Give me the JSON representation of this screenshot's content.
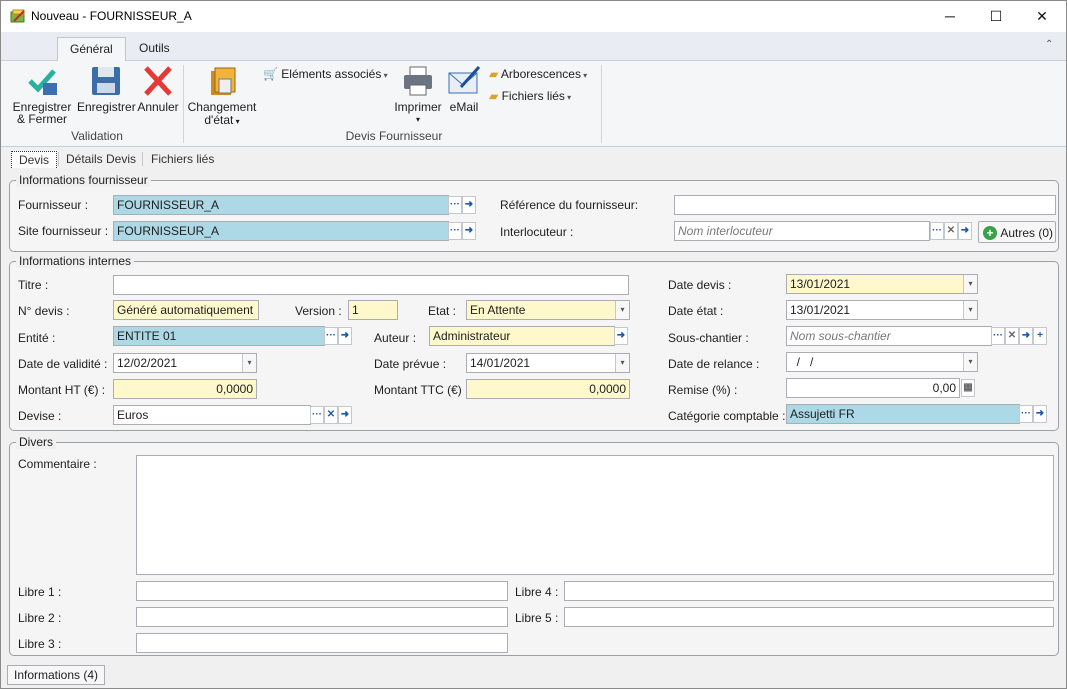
{
  "window": {
    "title": "Nouveau - FOURNISSEUR_A"
  },
  "ribbon": {
    "tabs": [
      "Général",
      "Outils"
    ],
    "validation": {
      "save_close": "Enregistrer\n& Fermer",
      "save": "Enregistrer",
      "cancel": "Annuler",
      "group_label": "Validation"
    },
    "devis": {
      "change_state": "Changement",
      "change_state2": "d'état",
      "associated": "Eléments associés",
      "print": "Imprimer",
      "email": "eMail",
      "trees": "Arborescences",
      "linked_files": "Fichiers liés",
      "group_label": "Devis Fournisseur"
    }
  },
  "doc_tabs": [
    "Devis",
    "Détails Devis",
    "Fichiers liés"
  ],
  "fournisseur": {
    "section": "Informations fournisseur",
    "supplier_label": "Fournisseur :",
    "supplier_value": "FOURNISSEUR_A",
    "site_label": "Site fournisseur :",
    "site_value": "FOURNISSEUR_A",
    "ref_label": "Référence du fournisseur:",
    "ref_value": "",
    "contact_label": "Interlocuteur :",
    "contact_placeholder": "Nom interlocuteur",
    "others_button": "Autres (0)"
  },
  "internes": {
    "section": "Informations internes",
    "titre_label": "Titre :",
    "titre_value": "",
    "num_label": "N° devis :",
    "num_value": "Généré automatiquement",
    "version_label": "Version :",
    "version_value": "1",
    "etat_label": "Etat :",
    "etat_value": "En Attente",
    "entite_label": "Entité :",
    "entite_value": "ENTITE 01",
    "auteur_label": "Auteur :",
    "auteur_value": "Administrateur",
    "validite_label": "Date de validité :",
    "validite_value": "12/02/2021",
    "prevue_label": "Date prévue :",
    "prevue_value": "14/01/2021",
    "ht_label": "Montant HT (€) :",
    "ht_value": "0,0000",
    "ttc_label": "Montant TTC (€) :",
    "ttc_value": "0,0000",
    "devise_label": "Devise :",
    "devise_value": "Euros",
    "date_devis_label": "Date devis :",
    "date_devis_value": "13/01/2021",
    "date_etat_label": "Date état :",
    "date_etat_value": "13/01/2021",
    "sous_chantier_label": "Sous-chantier :",
    "sous_chantier_placeholder": "Nom sous-chantier",
    "relance_label": "Date de relance :",
    "relance_value": "  /   /",
    "remise_label": "Remise (%) :",
    "remise_value": "0,00",
    "categorie_label": "Catégorie comptable :",
    "categorie_value": "Assujetti FR"
  },
  "divers": {
    "section": "Divers",
    "comment_label": "Commentaire :",
    "libre1": "Libre 1 :",
    "libre2": "Libre 2 :",
    "libre3": "Libre 3 :",
    "libre4": "Libre 4 :",
    "libre5": "Libre 5 :"
  },
  "status": {
    "info_button": "Informations (4)"
  }
}
